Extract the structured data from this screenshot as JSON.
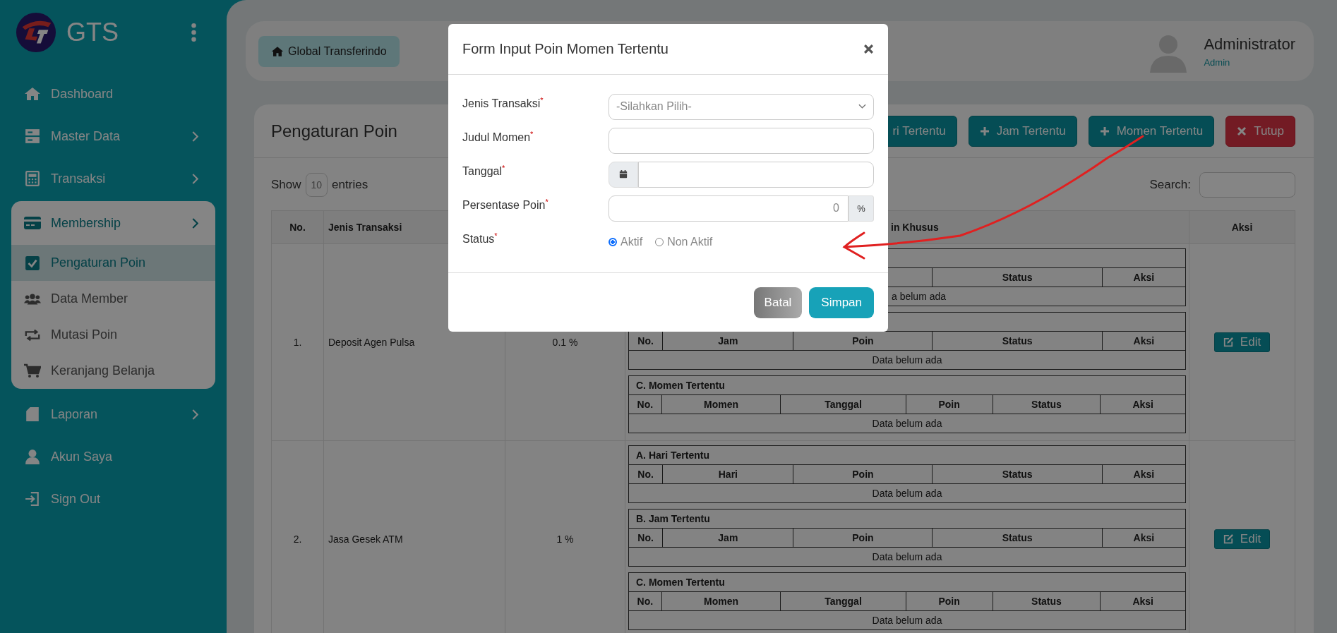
{
  "sidebar": {
    "brand": "GTS",
    "items": [
      {
        "label": "Dashboard",
        "has_arrow": false
      },
      {
        "label": "Master Data",
        "has_arrow": true
      },
      {
        "label": "Transaksi",
        "has_arrow": true
      },
      {
        "label": "Membership",
        "has_arrow": true,
        "children": [
          {
            "label": "Pengaturan Poin",
            "selected": true
          },
          {
            "label": "Data Member",
            "selected": false
          },
          {
            "label": "Mutasi Poin",
            "selected": false
          },
          {
            "label": "Keranjang Belanja",
            "selected": false
          }
        ]
      },
      {
        "label": "Laporan",
        "has_arrow": true
      },
      {
        "label": "Akun Saya",
        "has_arrow": false
      },
      {
        "label": "Sign Out",
        "has_arrow": false
      }
    ]
  },
  "header": {
    "breadcrumb": "Global Transferindo",
    "user": {
      "name": "Administrator",
      "role": "Admin"
    }
  },
  "card": {
    "title": "Pengaturan Poin",
    "buttons": [
      {
        "label": "ri Tertentu",
        "kind": "primary",
        "plus_icon": false
      },
      {
        "label": "Jam Tertentu",
        "kind": "primary",
        "plus_icon": true
      },
      {
        "label": "Momen Tertentu",
        "kind": "primary",
        "plus_icon": true
      },
      {
        "label": "Tutup",
        "kind": "danger",
        "plus_icon": false
      }
    ],
    "show_label": "Show",
    "page_size": "10",
    "entries_label": "entries",
    "search_label": "Search:"
  },
  "table": {
    "columns": [
      {
        "label": "No."
      },
      {
        "label": "Jenis Transaksi"
      },
      {
        "label": "in Khusus"
      },
      {
        "label": "Aksi"
      }
    ],
    "rows": [
      {
        "no": "1.",
        "name": "Deposit Agen Pulsa",
        "poin": "0.1 %",
        "action": "Edit",
        "sections": [
          {
            "kind": "hari",
            "columns": [
              "Status",
              "Aksi"
            ],
            "empty_text": "a belum ada"
          },
          {
            "kind": "jam",
            "columns": [
              "No.",
              "Jam",
              "Poin",
              "Status",
              "Aksi"
            ],
            "empty_text": "Data belum ada"
          },
          {
            "kind": "momen",
            "title": "C. Momen Tertentu",
            "columns": [
              "No.",
              "Momen",
              "Tanggal",
              "Poin",
              "Status",
              "Aksi"
            ],
            "empty_text": "Data belum ada"
          }
        ]
      },
      {
        "no": "2.",
        "name": "Jasa Gesek ATM",
        "poin": "1 %",
        "action": "Edit",
        "sections": [
          {
            "kind": "hari",
            "title": "A. Hari Tertentu",
            "columns": [
              "No.",
              "Hari",
              "Poin",
              "Status",
              "Aksi"
            ],
            "empty_text": "Data belum ada"
          },
          {
            "kind": "jam",
            "title": "B. Jam Tertentu",
            "columns": [
              "No.",
              "Jam",
              "Poin",
              "Status",
              "Aksi"
            ],
            "empty_text": "Data belum ada"
          },
          {
            "kind": "momen",
            "title": "C. Momen Tertentu",
            "columns": [
              "No.",
              "Momen",
              "Tanggal",
              "Poin",
              "Status",
              "Aksi"
            ],
            "empty_text": "Data belum ada"
          }
        ]
      }
    ]
  },
  "modal": {
    "title": "Form Input Poin Momen Tertentu",
    "fields": [
      {
        "label": "Jenis Transaksi",
        "required_mark": "*",
        "kind": "select",
        "placeholder": "-Silahkan Pilih-"
      },
      {
        "label": "Judul Momen",
        "required_mark": "*",
        "kind": "text"
      },
      {
        "label": "Tanggal",
        "required_mark": "*",
        "kind": "date"
      },
      {
        "label": "Persentase Poin",
        "required_mark": "*",
        "kind": "number",
        "placeholder": "0",
        "suffix": "%"
      },
      {
        "label": "Status",
        "required_mark": "*",
        "kind": "radio",
        "options": [
          {
            "label": "Aktif",
            "selected": true
          },
          {
            "label": "Non Aktif",
            "selected": false
          }
        ]
      }
    ],
    "buttons": [
      {
        "label": "Batal",
        "kind": "secondary"
      },
      {
        "label": "Simpan",
        "kind": "primary"
      }
    ]
  }
}
